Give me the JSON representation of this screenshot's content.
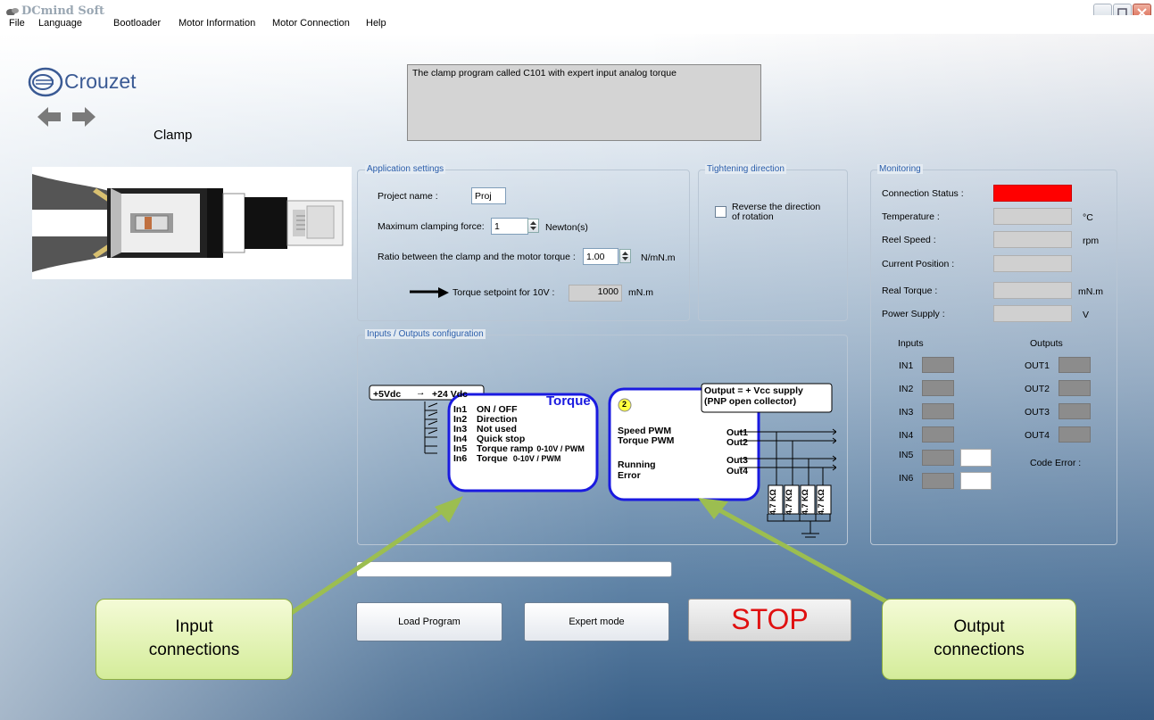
{
  "window": {
    "title": "DCmind Soft"
  },
  "menu": [
    "File",
    "Language",
    "Bootloader",
    "Motor Information",
    "Motor Connection",
    "Help"
  ],
  "logo": {
    "brand": "Crouzet"
  },
  "page": {
    "title": "Clamp",
    "description": "The clamp program called C101 with expert input analog torque"
  },
  "app_settings": {
    "title": "Application settings",
    "project_label": "Project name :",
    "project_value": "Proj",
    "max_force_label": "Maximum clamping force:",
    "max_force_value": "1",
    "max_force_unit": "Newton(s)",
    "ratio_label": "Ratio between the clamp and the motor torque :",
    "ratio_value": "1.00",
    "ratio_unit": "N/mN.m",
    "setpoint_label": "Torque setpoint for 10V :",
    "setpoint_value": "1000",
    "setpoint_unit": "mN.m"
  },
  "tightening": {
    "title": "Tightening direction",
    "reverse_label": "Reverse the direction of rotation",
    "checked": false
  },
  "monitoring": {
    "title": "Monitoring",
    "connection_label": "Connection Status :",
    "connection_color": "#ff0000",
    "temperature_label": "Temperature :",
    "temperature_unit": "°C",
    "speed_label": "Reel Speed :",
    "speed_unit": "rpm",
    "position_label": "Current Position :",
    "torque_label": "Real Torque :",
    "torque_unit": "mN.m",
    "power_label": "Power Supply :",
    "power_unit": "V",
    "inputs_title": "Inputs",
    "outputs_title": "Outputs",
    "inputs": [
      "IN1",
      "IN2",
      "IN3",
      "IN4",
      "IN5",
      "IN6"
    ],
    "outputs": [
      "OUT1",
      "OUT2",
      "OUT3",
      "OUT4"
    ],
    "code_error_label": "Code Error :"
  },
  "io_config": {
    "title": "Inputs / Outputs configuration",
    "supply": "+5Vdc",
    "supply_to": "+24 Vdc",
    "arrow": "→",
    "torque_title": "Torque",
    "inputs": [
      {
        "name": "In1",
        "desc": "ON / OFF",
        "note": ""
      },
      {
        "name": "In2",
        "desc": "Direction",
        "note": ""
      },
      {
        "name": "In3",
        "desc": "Not used",
        "note": ""
      },
      {
        "name": "In4",
        "desc": "Quick stop",
        "note": ""
      },
      {
        "name": "In5",
        "desc": "Torque ramp",
        "note": "0-10V / PWM"
      },
      {
        "name": "In6",
        "desc": "Torque",
        "note": "0-10V / PWM"
      }
    ],
    "badge": "2",
    "output_header_1": "Output = + Vcc supply",
    "output_header_2": "(PNP open collector)",
    "outputs": [
      {
        "desc": "Speed PWM",
        "name": "Out1"
      },
      {
        "desc": "Torque PWM",
        "name": "Out2"
      },
      {
        "desc": "Running",
        "name": "Out3"
      },
      {
        "desc": "Error",
        "name": "Out4"
      }
    ],
    "resistor": "4.7 KΩ"
  },
  "buttons": {
    "load": "Load Program",
    "expert": "Expert mode",
    "stop": "STOP"
  },
  "progress": {
    "value": 0
  },
  "callouts": {
    "input": "Input\nconnections",
    "output": "Output\nconnections"
  },
  "colors": {
    "stop": "#e01010",
    "diagram_blue": "#1a1ae0",
    "callout": "#d4ec9a"
  }
}
